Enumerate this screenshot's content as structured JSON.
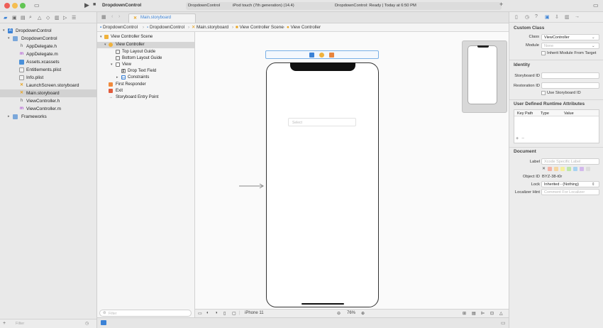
{
  "titlebar": {
    "project": "DropdownControl",
    "scheme": "DropdownControl",
    "device": "iPod touch (7th generation) (14.4)",
    "status": "DropdownControl: Ready | Today at 6:50 PM"
  },
  "navigator": {
    "items": [
      {
        "label": "DropdownControl",
        "icon": "project-icon",
        "kind": "project"
      },
      {
        "label": "DropdownControl",
        "icon": "folder-icon",
        "kind": "folder"
      },
      {
        "label": "AppDelegate.h",
        "icon": "header-file-icon",
        "kind": "h"
      },
      {
        "label": "AppDelegate.m",
        "icon": "objc-file-icon",
        "kind": "m"
      },
      {
        "label": "Assets.xcassets",
        "icon": "assets-icon",
        "kind": "assets"
      },
      {
        "label": "Entitlements.plist",
        "icon": "plist-icon",
        "kind": "plist"
      },
      {
        "label": "Info.plist",
        "icon": "plist-icon",
        "kind": "plist"
      },
      {
        "label": "LaunchScreen.storyboard",
        "icon": "storyboard-icon",
        "kind": "storyboard"
      },
      {
        "label": "Main.storyboard",
        "icon": "storyboard-icon",
        "kind": "storyboard"
      },
      {
        "label": "ViewController.h",
        "icon": "header-file-icon",
        "kind": "h"
      },
      {
        "label": "ViewController.m",
        "icon": "objc-file-icon",
        "kind": "m"
      },
      {
        "label": "Frameworks",
        "icon": "folder-icon",
        "kind": "folder"
      }
    ],
    "filter_placeholder": "Filter"
  },
  "tabs": {
    "active": "Main.storyboard"
  },
  "jumpbar": [
    "DropdownControl",
    "DropdownControl",
    "Main.storyboard",
    "View Controller Scene",
    "View Controller"
  ],
  "outline": {
    "items": [
      {
        "label": "View Controller Scene",
        "icon": "scene-icon"
      },
      {
        "label": "View Controller",
        "icon": "view-controller-icon"
      },
      {
        "label": "Top Layout Guide",
        "icon": "layout-guide-icon"
      },
      {
        "label": "Bottom Layout Guide",
        "icon": "layout-guide-icon"
      },
      {
        "label": "View",
        "icon": "view-icon"
      },
      {
        "label": "Drop Text Field",
        "icon": "text-field-icon"
      },
      {
        "label": "Constraints",
        "icon": "constraints-icon"
      },
      {
        "label": "First Responder",
        "icon": "first-responder-icon"
      },
      {
        "label": "Exit",
        "icon": "exit-icon"
      },
      {
        "label": "Storyboard Entry Point",
        "icon": "entry-point-icon"
      }
    ],
    "filter_placeholder": "Filter"
  },
  "canvas": {
    "dropdown_placeholder": "Select",
    "device_label": "iPhone 11",
    "zoom": "76%"
  },
  "inspector": {
    "custom_class": {
      "title": "Custom Class",
      "class_label": "Class",
      "class_value": "ViewController",
      "module_label": "Module",
      "module_value": "None",
      "inherit_label": "Inherit Module From Target"
    },
    "identity": {
      "title": "Identity",
      "storyboard_id_label": "Storyboard ID",
      "restoration_id_label": "Restoration ID",
      "use_storyboard_id_label": "Use Storyboard ID"
    },
    "udra": {
      "title": "User Defined Runtime Attributes",
      "col_keypath": "Key Path",
      "col_type": "Type",
      "col_value": "Value"
    },
    "document": {
      "title": "Document",
      "label_label": "Label",
      "label_placeholder": "Xcode Specific Label",
      "object_id_label": "Object ID",
      "object_id_value": "BYZ-38-t0r",
      "lock_label": "Lock",
      "lock_value": "Inherited - (Nothing)",
      "localizer_label": "Localizer Hint",
      "localizer_placeholder": "Comment For Localizer"
    },
    "swatch_colors": [
      "#f4b2a6",
      "#f5d5a0",
      "#f5ef9c",
      "#bfe6a8",
      "#a8d3f2",
      "#d3b8ec",
      "#dcdcdc"
    ]
  }
}
